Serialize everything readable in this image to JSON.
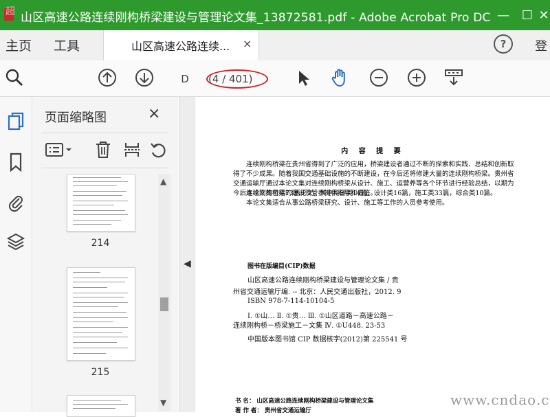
{
  "window": {
    "title": "山区高速公路连续刚构桥梁建设与管理论文集_13872581.pdf - Adobe Acrobat Pro DC",
    "watermark_top": "超",
    "controls": {
      "minimize": "—",
      "maximize": "☐",
      "close": "✕"
    }
  },
  "tabs": {
    "home": "主页",
    "tools": "工具",
    "document_tab": "山区高速公路连续...",
    "close": "×",
    "help": "?",
    "login": "登"
  },
  "toolbar": {
    "page_input_value": "D",
    "page_count": "(4 / 401)",
    "icons": [
      "zoom-search-icon",
      "arrow-up-icon",
      "arrow-down-icon",
      "cursor-icon",
      "hand-icon",
      "zoom-out-icon",
      "zoom-in-icon",
      "scroll-mode-icon"
    ]
  },
  "thumbnail_panel": {
    "title": "页面缩略图",
    "close": "×",
    "thumbnails": [
      {
        "label": "214"
      },
      {
        "label": "215"
      }
    ]
  },
  "document": {
    "heading": "内 容 提 要",
    "paragraphs": [
      "连续刚构桥梁在贵州省得到了广泛的应用，桥梁建设者通过不断的探索和实践、总结和创新取得了不少成果。随着我国交通基础设施的不断建设，在今后还将修建大量的连续刚构桥梁。贵州省交通运输厅通过本论文集对连续刚构桥梁从设计、施工、运营养等各个环节进行经验总结，以期为今后连续刚构桥梁的建设及管养提供指导和借鉴。",
      "本论文集包括73篇论文，其中科研类14篇，设计类16篇，施工类33篇，综合类10篇。",
      "本论文集适合从事公路桥梁研究、设计、施工等工作的人员参考使用。"
    ],
    "cip_title": "图书在版编目(CIP)数据",
    "cip_lines": [
      "山区高速公路连续刚构桥梁建设与管理论文集 / 贵",
      "州省交通运输厅编. -- 北京：人民交通出版社，2012. 9",
      "ISBN 978-7-114-10104-5",
      "Ⅰ. ①山…   Ⅱ. ①贵…   Ⅲ. ①山区道路－高速公路－",
      "连续刚构桥－桥梁施工－文集   Ⅳ. ①U448. 23-53",
      "中国版本图书馆 CIP 数据核字(2012)第 225541 号"
    ],
    "footer_lines": [
      "书    名： 山区高速公路连续刚构桥梁建设与管理论文集",
      "著 作 者： 贵州省交通运输厅"
    ]
  },
  "watermark": "www.cndao.com",
  "colors": {
    "title_bar": "#2e9a2e",
    "annotation": "#d42020",
    "icon_blue": "#2a6fc1"
  }
}
